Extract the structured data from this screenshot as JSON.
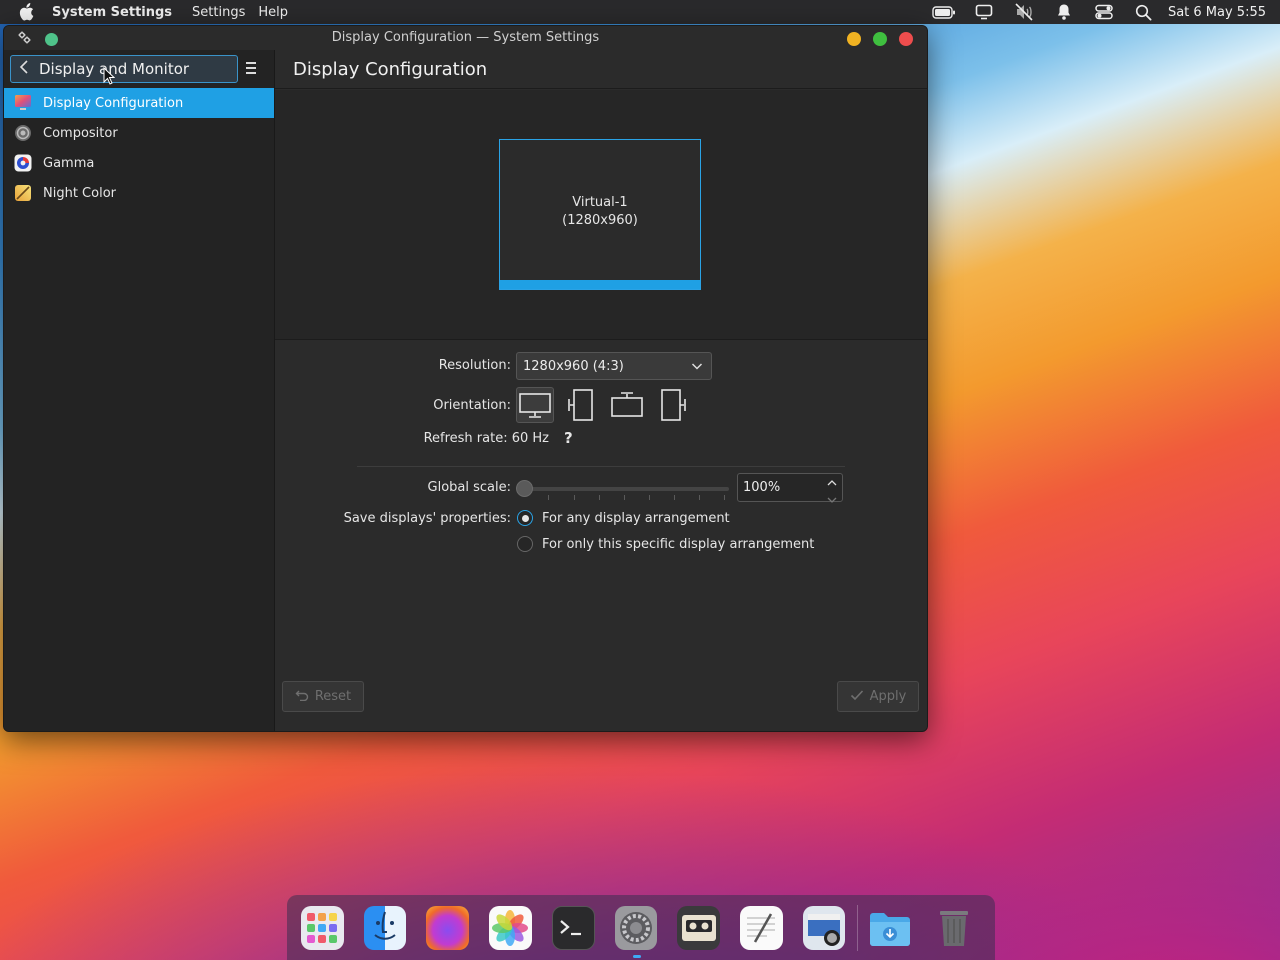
{
  "menubar": {
    "app_name": "System Settings",
    "menus": [
      "Settings",
      "Help"
    ],
    "clock": "Sat 6 May 5:55"
  },
  "window": {
    "title": "Display Configuration — System Settings"
  },
  "sidebar": {
    "back_label": "Display and Monitor",
    "items": [
      {
        "label": "Display Configuration",
        "icon": "display-config-icon",
        "active": true
      },
      {
        "label": "Compositor",
        "icon": "compositor-icon",
        "active": false
      },
      {
        "label": "Gamma",
        "icon": "gamma-icon",
        "active": false
      },
      {
        "label": "Night Color",
        "icon": "night-color-icon",
        "active": false
      }
    ]
  },
  "main": {
    "header": "Display Configuration",
    "monitor": {
      "name": "Virtual-1",
      "size": "(1280x960)"
    },
    "resolution_label": "Resolution:",
    "resolution_value": "1280x960 (4:3)",
    "orientation_label": "Orientation:",
    "refresh_label": "Refresh rate: 60 Hz",
    "help_glyph": "?",
    "global_scale_label": "Global scale:",
    "global_scale_value": "100%",
    "global_scale_level": 0,
    "save_label": "Save displays' properties:",
    "save_options": [
      {
        "label": "For any display arrangement",
        "selected": true
      },
      {
        "label": "For only this specific display arrangement",
        "selected": false
      }
    ],
    "reset_label": "Reset",
    "apply_label": "Apply"
  },
  "dock": {
    "apps": [
      "launcher-icon",
      "finder-icon",
      "firefox-icon",
      "photos-icon",
      "terminal-icon",
      "system-settings-icon",
      "media-player-icon",
      "text-editor-icon",
      "screenshot-icon",
      "downloads-folder-icon",
      "trash-icon"
    ]
  },
  "colors": {
    "accent": "#1fa0e4",
    "window_bg": "#2b2b2b",
    "sidebar_bg": "#232323"
  }
}
